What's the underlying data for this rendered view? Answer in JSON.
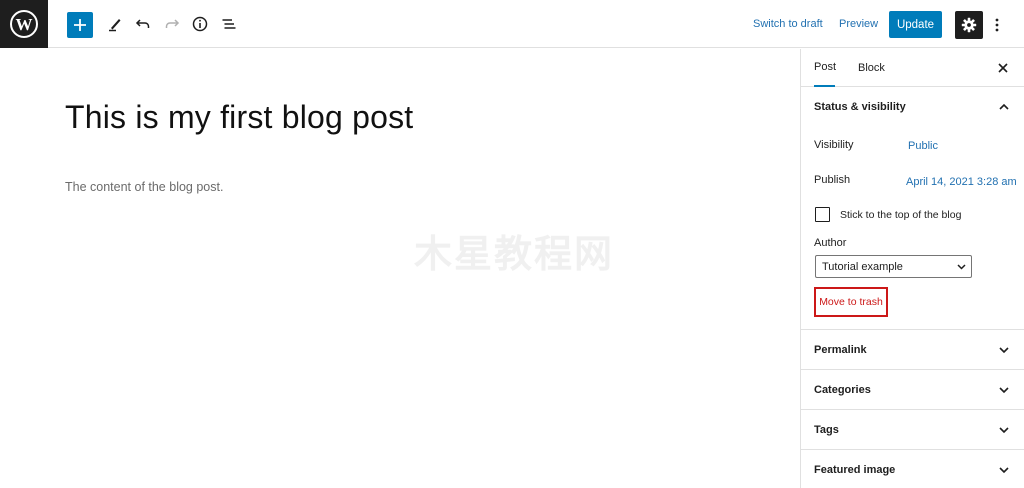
{
  "toolbar": {
    "switch_to_draft": "Switch to draft",
    "preview": "Preview",
    "update": "Update"
  },
  "editor": {
    "title": "This is my first blog post",
    "content": "The content of the blog post.",
    "watermark": "木星教程网"
  },
  "sidebar": {
    "tabs": [
      "Post",
      "Block"
    ],
    "status_visibility": {
      "heading": "Status & visibility",
      "visibility_label": "Visibility",
      "visibility_value": "Public",
      "publish_label": "Publish",
      "publish_value": "April 14, 2021 3:28 am",
      "sticky_label": "Stick to the top of the blog",
      "author_label": "Author",
      "author_value": "Tutorial example",
      "trash": "Move to trash"
    },
    "panels": [
      "Permalink",
      "Categories",
      "Tags",
      "Featured image"
    ]
  },
  "colors": {
    "accent": "#007cba",
    "link": "#2271b1",
    "danger": "#cc1818",
    "dark": "#1e1e1e"
  },
  "icons": [
    "wordpress-logo-icon",
    "plus-icon",
    "pencil-icon",
    "undo-icon",
    "redo-icon",
    "info-icon",
    "list-view-icon",
    "gear-icon",
    "more-vertical-icon",
    "close-icon",
    "chevron-up-icon",
    "chevron-down-icon"
  ]
}
